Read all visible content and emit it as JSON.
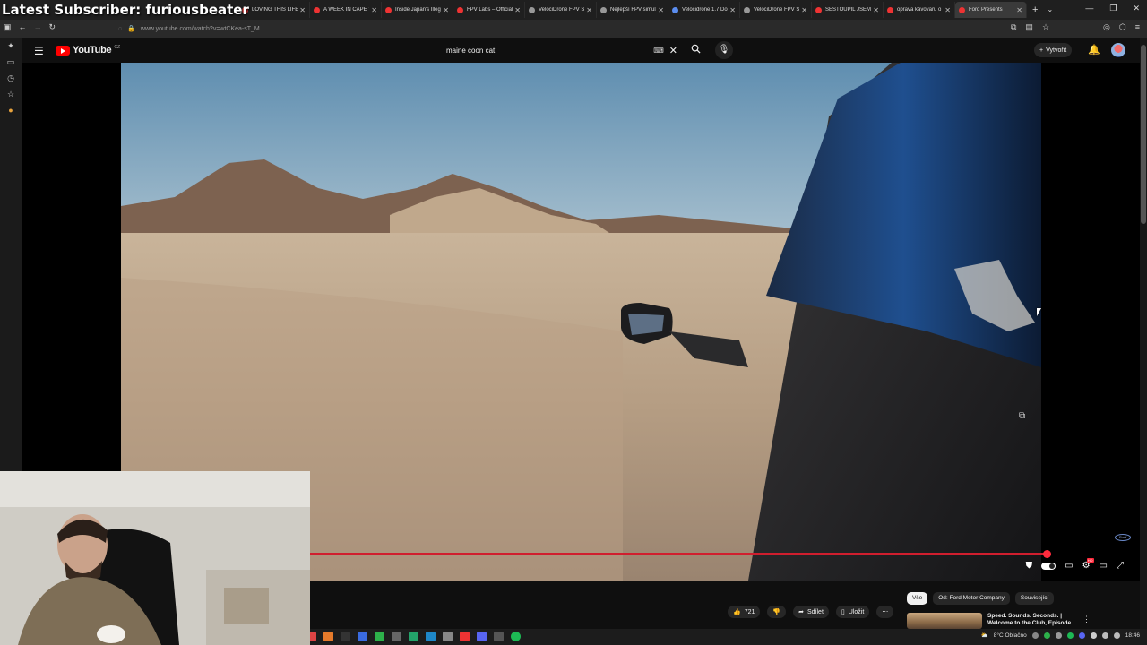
{
  "overlay": {
    "stream_title": "Latest Subscriber: furiousbeater"
  },
  "browser": {
    "tabs": [
      {
        "label": "LOVING THIS LIFE",
        "icon": "youtube-icon"
      },
      {
        "label": "A WEEK IN CAPE Y",
        "icon": "youtube-icon"
      },
      {
        "label": "Inside Japan's Illeg",
        "icon": "youtube-icon"
      },
      {
        "label": "FPV Labs – Official",
        "icon": "youtube-icon"
      },
      {
        "label": "VelociDrone FPV Si",
        "icon": "web-icon"
      },
      {
        "label": "Nejlepší FPV simulá",
        "icon": "web-icon"
      },
      {
        "label": "Velocidrone 1.7 Do",
        "icon": "google-icon"
      },
      {
        "label": "VelociDrone FPV Si",
        "icon": "web-icon"
      },
      {
        "label": "SESTOUPIL JSEM D",
        "icon": "youtube-icon"
      },
      {
        "label": "oprava kávovaru o",
        "icon": "youtube-icon"
      },
      {
        "label": "Ford Presents",
        "icon": "youtube-icon",
        "active": true
      }
    ],
    "new_tab": "+",
    "url": "www.youtube.com/watch?v=wtCKea-sT_M"
  },
  "youtube": {
    "logo_text": "YouTube",
    "region": "CZ",
    "search": {
      "value": "maine coon cat"
    },
    "create_label": "Vytvořit"
  },
  "video": {
    "progress": 0.99,
    "watermark": "Ford"
  },
  "actions": {
    "like_count": "721",
    "share_label": "Sdílet",
    "save_label": "Uložit"
  },
  "chips": [
    "Vše",
    "Od: Ford Motor Company",
    "Související"
  ],
  "recommendation": {
    "title_line1": "Speed. Sounds. Seconds. |",
    "title_line2": "Welcome to the Club, Episode ..."
  },
  "taskbar": {
    "weather": "8°C  Oblačno",
    "time": "18:46"
  },
  "colors": {
    "youtube_red": "#ff0000",
    "progress_red": "#d01e2e",
    "background": "#0f0f0f"
  }
}
